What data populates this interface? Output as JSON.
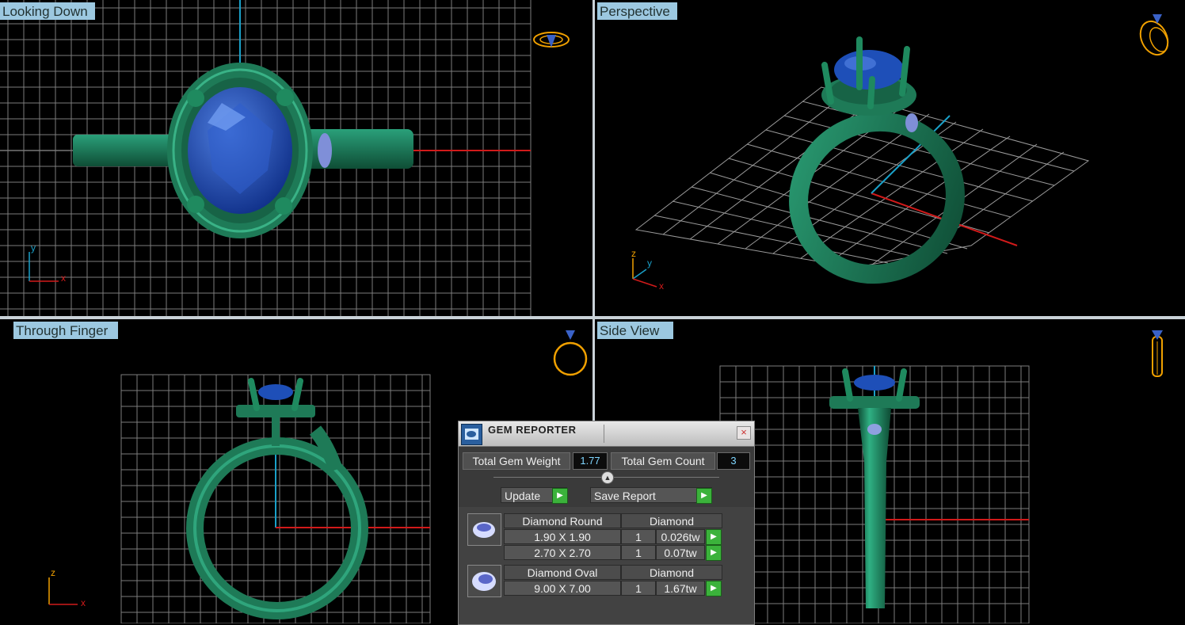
{
  "viewports": {
    "top_left": {
      "label": "Looking Down",
      "axes": [
        "y",
        "x"
      ]
    },
    "top_right": {
      "label": "Perspective",
      "axes": [
        "z",
        "y",
        "x"
      ]
    },
    "bottom_left": {
      "label": "Through Finger",
      "axes": [
        "z",
        "x"
      ]
    },
    "bottom_right": {
      "label": "Side View"
    }
  },
  "gem_reporter": {
    "title": "GEM REPORTER",
    "close_glyph": "×",
    "total_weight_label": "Total Gem Weight",
    "total_weight_value": "1.77",
    "total_count_label": "Total Gem Count",
    "total_count_value": "3",
    "update_label": "Update",
    "save_report_label": "Save Report",
    "gems": [
      {
        "shape": "Diamond Round",
        "material": "Diamond",
        "rows": [
          {
            "size": "1.90 X 1.90",
            "qty": "1",
            "weight": "0.026tw"
          },
          {
            "size": "2.70 X 2.70",
            "qty": "1",
            "weight": "0.07tw"
          }
        ]
      },
      {
        "shape": "Diamond Oval",
        "material": "Diamond",
        "rows": [
          {
            "size": "9.00 X 7.00",
            "qty": "1",
            "weight": "1.67tw"
          }
        ]
      }
    ]
  },
  "colors": {
    "metal": "#1e7a57",
    "gem": "#1e4fb8",
    "grid": "#8a8a8a",
    "axis_x": "#d11a1a",
    "axis_y": "#1aa0c8",
    "gizmo": "#f0a000"
  }
}
